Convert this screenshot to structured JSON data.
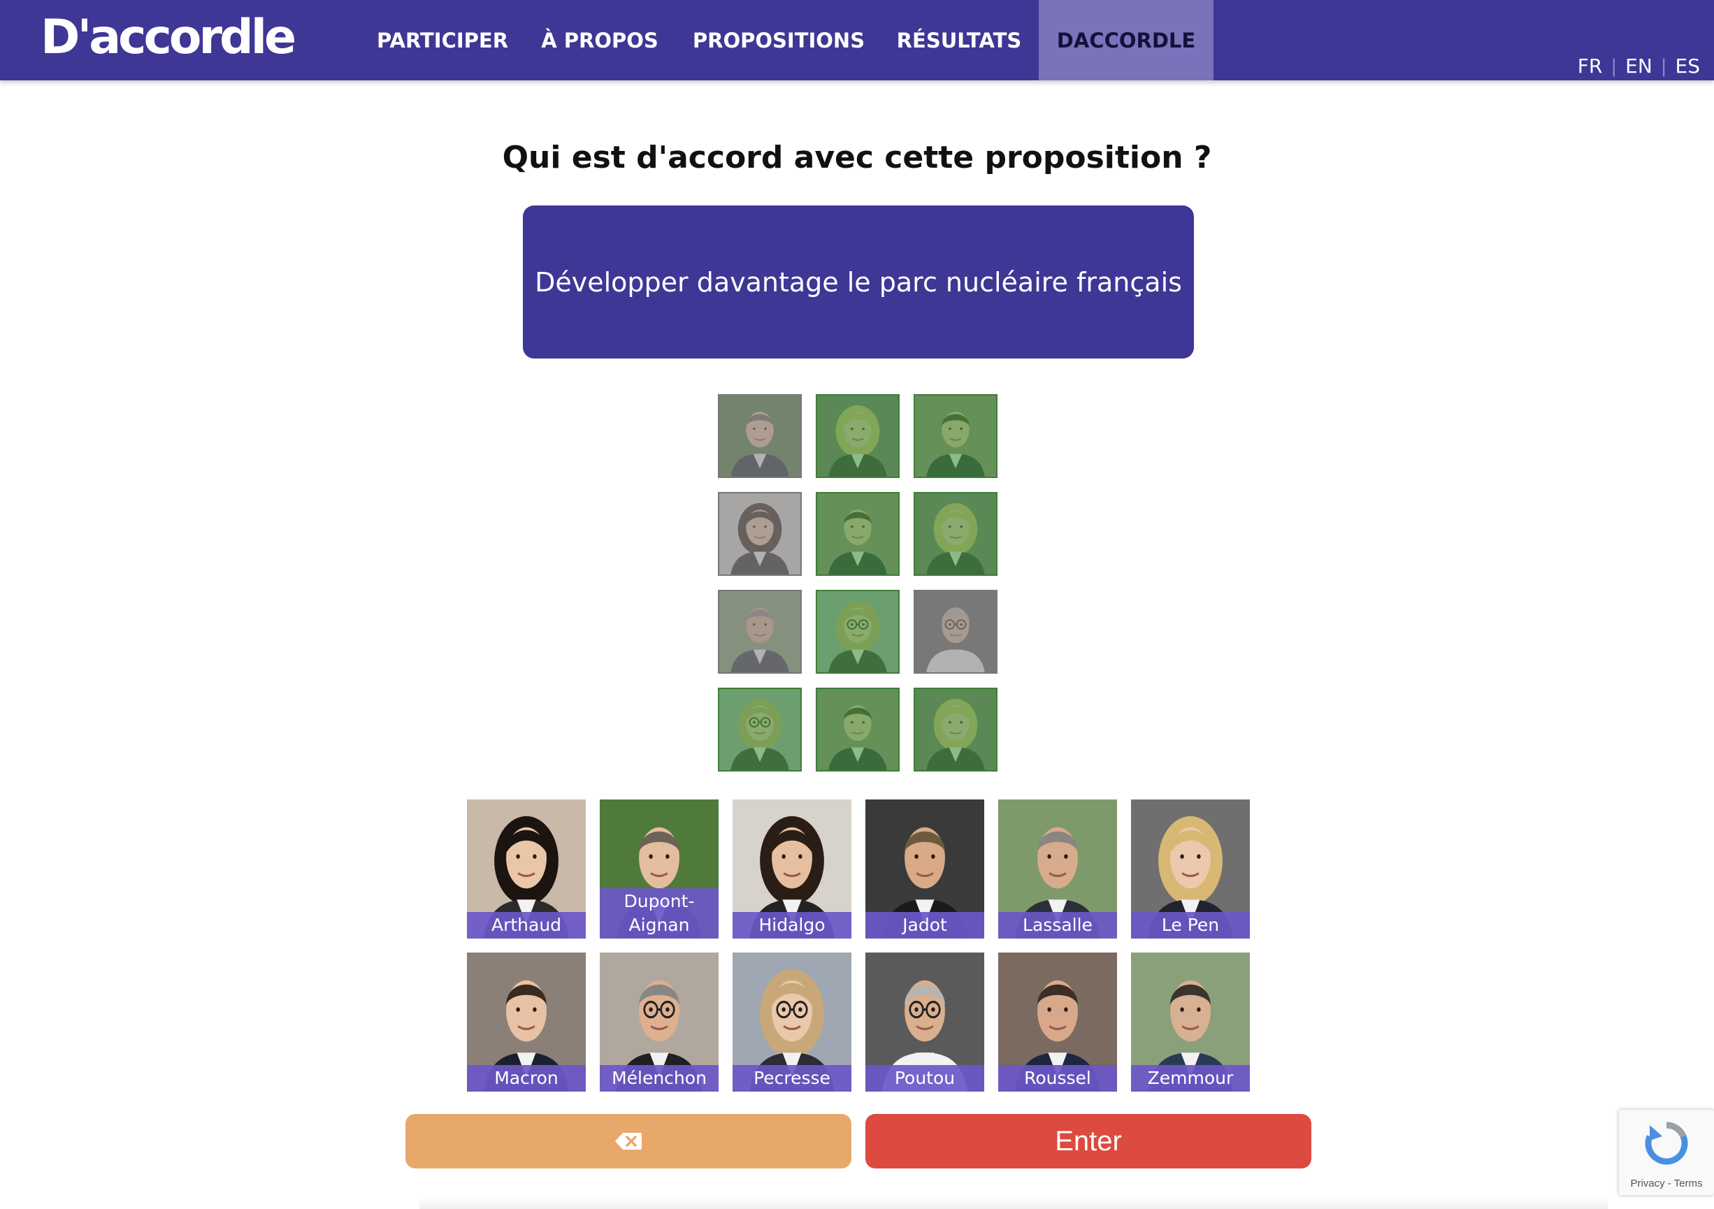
{
  "header": {
    "logo": "D'accordle",
    "nav": [
      {
        "label": "PARTICIPER"
      },
      {
        "label": "À PROPOS"
      },
      {
        "label": "PROPOSITIONS"
      },
      {
        "label": "RÉSULTATS"
      },
      {
        "label": "DACCORDLE",
        "active": true
      }
    ],
    "languages": [
      "FR",
      "EN",
      "ES"
    ],
    "colors": {
      "bar": "#3e3795",
      "active_tab": "#7873ba"
    }
  },
  "question": "Qui est d'accord avec cette proposition ?",
  "proposal": "Développer davantage le parc nucléaire français",
  "guesses": [
    [
      {
        "state": "grey",
        "face": "dupont-aignan-face"
      },
      {
        "state": "green",
        "face": "le-pen-face"
      },
      {
        "state": "green",
        "face": "macron-face"
      }
    ],
    [
      {
        "state": "grey",
        "face": "hidalgo-face"
      },
      {
        "state": "green",
        "face": "macron-face"
      },
      {
        "state": "green",
        "face": "le-pen-face"
      }
    ],
    [
      {
        "state": "grey",
        "face": "lassalle-face"
      },
      {
        "state": "green",
        "face": "pecresse-face"
      },
      {
        "state": "grey",
        "face": "poutou-face"
      }
    ],
    [
      {
        "state": "green",
        "face": "pecresse-face"
      },
      {
        "state": "green",
        "face": "macron-face"
      },
      {
        "state": "green",
        "face": "le-pen-face"
      }
    ]
  ],
  "candidates": [
    {
      "label": "Arthaud"
    },
    {
      "label": "Dupont-\nAignan"
    },
    {
      "label": "Hidalgo"
    },
    {
      "label": "Jadot"
    },
    {
      "label": "Lassalle"
    },
    {
      "label": "Le Pen"
    },
    {
      "label": "Macron"
    },
    {
      "label": "Mélenchon"
    },
    {
      "label": "Pecresse"
    },
    {
      "label": "Poutou"
    },
    {
      "label": "Roussel"
    },
    {
      "label": "Zemmour"
    }
  ],
  "buttons": {
    "backspace_icon": "backspace-icon",
    "enter": "Enter"
  },
  "recaptcha": {
    "links": "Privacy - Terms"
  },
  "colors": {
    "green": "#4e9a46",
    "grey": "#8a8a8a",
    "backspace": "#e8a86a",
    "enter": "#dd4a3f",
    "label_bg": "#6b57c8"
  }
}
